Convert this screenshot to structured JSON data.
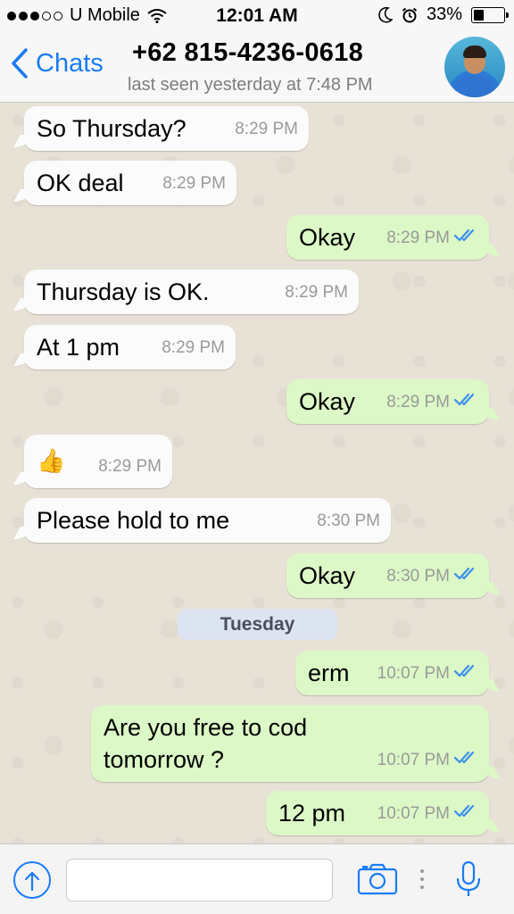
{
  "status_bar": {
    "carrier": "U Mobile",
    "time": "12:01 AM",
    "battery": "33%",
    "battery_level": 0.33
  },
  "header": {
    "back_label": "Chats",
    "contact_name": "+62 815-4236-0618",
    "last_seen": "last seen yesterday at 7:48 PM"
  },
  "messages": [
    {
      "dir": "in",
      "text": "So Thursday?",
      "time": "8:29 PM"
    },
    {
      "dir": "in",
      "text": "OK deal",
      "time": "8:29 PM"
    },
    {
      "dir": "out",
      "text": "Okay",
      "time": "8:29 PM"
    },
    {
      "dir": "in",
      "text": "Thursday is OK.",
      "time": "8:29 PM"
    },
    {
      "dir": "in",
      "text": "At 1 pm",
      "time": "8:29 PM"
    },
    {
      "dir": "out",
      "text": "Okay",
      "time": "8:29 PM"
    },
    {
      "dir": "in",
      "text": "👍",
      "time": "8:29 PM"
    },
    {
      "dir": "in",
      "text": "Please hold to me",
      "time": "8:30 PM"
    },
    {
      "dir": "out",
      "text": "Okay",
      "time": "8:30 PM"
    },
    {
      "dir": "out",
      "text": "erm",
      "time": "10:07 PM"
    },
    {
      "dir": "out",
      "text": "Are you free to cod tomorrow ?",
      "time": "10:07 PM"
    },
    {
      "dir": "out",
      "text": "12 pm",
      "time": "10:07 PM"
    }
  ],
  "date_separator": "Tuesday",
  "input": {
    "placeholder": ""
  },
  "colors": {
    "accent": "#1a7cf5",
    "outgoing_bubble": "#dcf8c6",
    "incoming_bubble": "#fbfbfb",
    "read_ticks": "#3b8ff0"
  },
  "icons": [
    "signal-icon",
    "wifi-icon",
    "moon-icon",
    "alarm-icon",
    "battery-icon",
    "back-chevron-icon",
    "read-ticks-icon",
    "upload-icon",
    "camera-icon",
    "more-dots-icon",
    "microphone-icon"
  ]
}
